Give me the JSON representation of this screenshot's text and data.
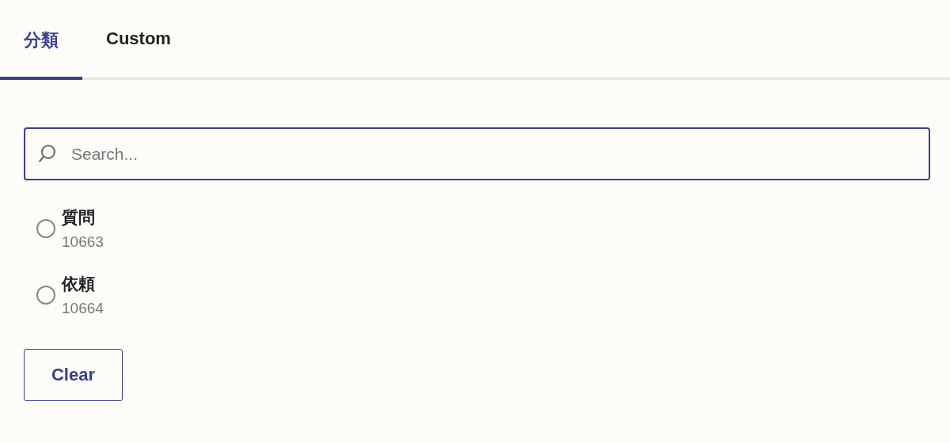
{
  "tabs": [
    {
      "label": "分類",
      "selected": true
    },
    {
      "label": "Custom",
      "selected": false
    }
  ],
  "search": {
    "placeholder": "Search..."
  },
  "options": [
    {
      "label": "質問",
      "id": "10663",
      "selected": false
    },
    {
      "label": "依頼",
      "id": "10664",
      "selected": false
    }
  ],
  "buttons": [
    "Clear"
  ]
}
